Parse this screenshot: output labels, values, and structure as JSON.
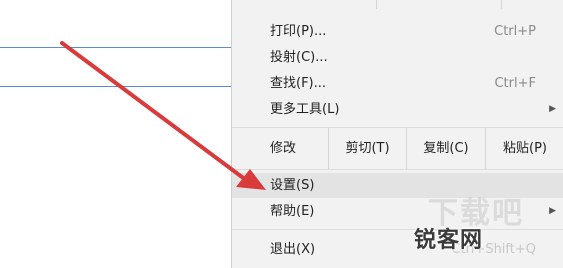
{
  "menu": {
    "items": [
      {
        "label": "打印(P)...",
        "shortcut": "Ctrl+P"
      },
      {
        "label": "投射(C)...",
        "shortcut": ""
      },
      {
        "label": "查找(F)...",
        "shortcut": "Ctrl+F"
      },
      {
        "label": "更多工具(L)",
        "shortcut": ""
      }
    ],
    "edit": {
      "label": "修改",
      "cut": "剪切(T)",
      "copy": "复制(C)",
      "paste": "粘贴(P)"
    },
    "settings": "设置(S)",
    "help": "帮助(E)",
    "exit": "退出(X)",
    "exit_shortcut": "Ctrl+Shift+Q"
  },
  "watermark": {
    "text": "锐客网",
    "ghost": "下载吧"
  },
  "colors": {
    "arrow": "#d93a3a",
    "menu_bg": "#f2f2f2",
    "highlight": "#e3e3e3",
    "bg_line": "#5b8bd0"
  }
}
